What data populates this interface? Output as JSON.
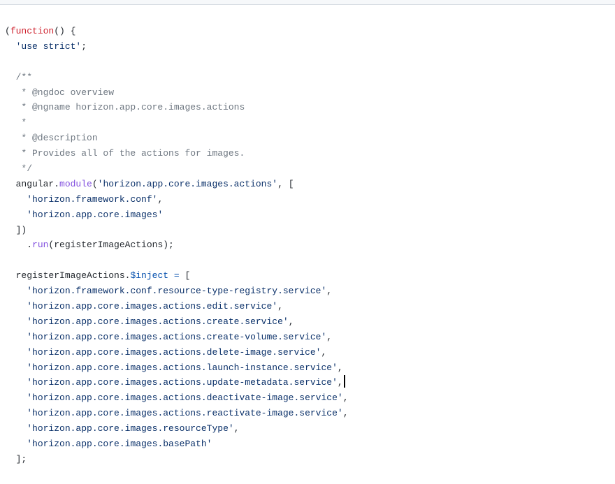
{
  "code": {
    "lines": [
      [
        {
          "t": "(",
          "c": "punc"
        },
        {
          "t": "function",
          "c": "kw"
        },
        {
          "t": "() {",
          "c": "punc"
        }
      ],
      [
        {
          "t": "  ",
          "c": "punc"
        },
        {
          "t": "'use strict'",
          "c": "str"
        },
        {
          "t": ";",
          "c": "punc"
        }
      ],
      [],
      [
        {
          "t": "  /**",
          "c": "com"
        }
      ],
      [
        {
          "t": "   * @ngdoc overview",
          "c": "com"
        }
      ],
      [
        {
          "t": "   * @ngname horizon.app.core.images.actions",
          "c": "com"
        }
      ],
      [
        {
          "t": "   *",
          "c": "com"
        }
      ],
      [
        {
          "t": "   * @description",
          "c": "com"
        }
      ],
      [
        {
          "t": "   * Provides all of the actions for images.",
          "c": "com"
        }
      ],
      [
        {
          "t": "   */",
          "c": "com"
        }
      ],
      [
        {
          "t": "  angular.",
          "c": "punc"
        },
        {
          "t": "module",
          "c": "prop"
        },
        {
          "t": "(",
          "c": "punc"
        },
        {
          "t": "'horizon.app.core.images.actions'",
          "c": "str"
        },
        {
          "t": ", [",
          "c": "punc"
        }
      ],
      [
        {
          "t": "    ",
          "c": "punc"
        },
        {
          "t": "'horizon.framework.conf'",
          "c": "str"
        },
        {
          "t": ",",
          "c": "punc"
        }
      ],
      [
        {
          "t": "    ",
          "c": "punc"
        },
        {
          "t": "'horizon.app.core.images'",
          "c": "str"
        }
      ],
      [
        {
          "t": "  ])",
          "c": "punc"
        }
      ],
      [
        {
          "t": "    .",
          "c": "punc"
        },
        {
          "t": "run",
          "c": "prop"
        },
        {
          "t": "(registerImageActions);",
          "c": "punc"
        }
      ],
      [],
      [
        {
          "t": "  registerImageActions.",
          "c": "punc"
        },
        {
          "t": "$inject",
          "c": "op"
        },
        {
          "t": " ",
          "c": "punc"
        },
        {
          "t": "=",
          "c": "op"
        },
        {
          "t": " [",
          "c": "punc"
        }
      ],
      [
        {
          "t": "    ",
          "c": "punc"
        },
        {
          "t": "'horizon.framework.conf.resource-type-registry.service'",
          "c": "str"
        },
        {
          "t": ",",
          "c": "punc"
        }
      ],
      [
        {
          "t": "    ",
          "c": "punc"
        },
        {
          "t": "'horizon.app.core.images.actions.edit.service'",
          "c": "str"
        },
        {
          "t": ",",
          "c": "punc"
        }
      ],
      [
        {
          "t": "    ",
          "c": "punc"
        },
        {
          "t": "'horizon.app.core.images.actions.create.service'",
          "c": "str"
        },
        {
          "t": ",",
          "c": "punc"
        }
      ],
      [
        {
          "t": "    ",
          "c": "punc"
        },
        {
          "t": "'horizon.app.core.images.actions.create-volume.service'",
          "c": "str"
        },
        {
          "t": ",",
          "c": "punc"
        }
      ],
      [
        {
          "t": "    ",
          "c": "punc"
        },
        {
          "t": "'horizon.app.core.images.actions.delete-image.service'",
          "c": "str"
        },
        {
          "t": ",",
          "c": "punc"
        }
      ],
      [
        {
          "t": "    ",
          "c": "punc"
        },
        {
          "t": "'horizon.app.core.images.actions.launch-instance.service'",
          "c": "str"
        },
        {
          "t": ",",
          "c": "punc"
        }
      ],
      [
        {
          "t": "    ",
          "c": "punc"
        },
        {
          "t": "'horizon.app.core.images.actions.update-metadata.service'",
          "c": "str"
        },
        {
          "t": ",",
          "c": "punc"
        },
        {
          "caret": true
        }
      ],
      [
        {
          "t": "    ",
          "c": "punc"
        },
        {
          "t": "'horizon.app.core.images.actions.deactivate-image.service'",
          "c": "str"
        },
        {
          "t": ",",
          "c": "punc"
        }
      ],
      [
        {
          "t": "    ",
          "c": "punc"
        },
        {
          "t": "'horizon.app.core.images.actions.reactivate-image.service'",
          "c": "str"
        },
        {
          "t": ",",
          "c": "punc"
        }
      ],
      [
        {
          "t": "    ",
          "c": "punc"
        },
        {
          "t": "'horizon.app.core.images.resourceType'",
          "c": "str"
        },
        {
          "t": ",",
          "c": "punc"
        }
      ],
      [
        {
          "t": "    ",
          "c": "punc"
        },
        {
          "t": "'horizon.app.core.images.basePath'",
          "c": "str"
        }
      ],
      [
        {
          "t": "  ];",
          "c": "punc"
        }
      ]
    ]
  }
}
